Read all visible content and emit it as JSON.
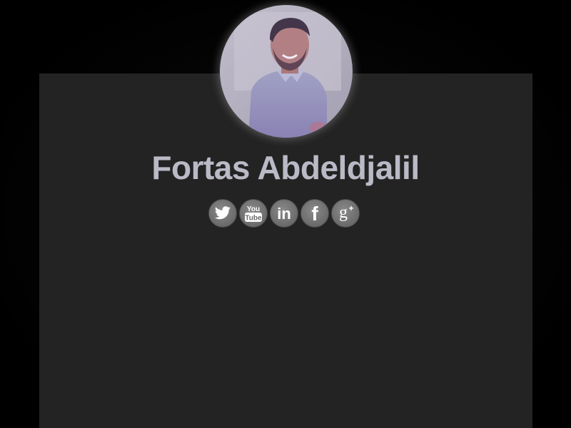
{
  "profile": {
    "name": "Fortas Abdeldjalil",
    "avatar_icon": "profile-photo"
  },
  "social": {
    "items": [
      {
        "icon": "twitter-icon",
        "color": "#ffffff"
      },
      {
        "icon": "youtube-icon",
        "label_top": "You",
        "label_bottom": "Tube"
      },
      {
        "icon": "linkedin-icon",
        "label": "in"
      },
      {
        "icon": "facebook-icon",
        "label": "f"
      },
      {
        "icon": "google-plus-icon",
        "label": "g",
        "sup": "+"
      }
    ]
  },
  "colors": {
    "background": "#000000",
    "card": "#232323",
    "name_text": "#b9bac6",
    "social_button": "#6e6e6e"
  }
}
